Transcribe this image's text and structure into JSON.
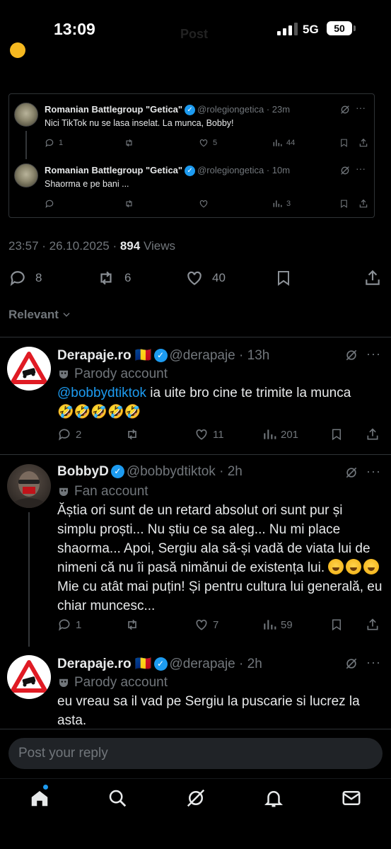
{
  "status_bar": {
    "time": "13:09",
    "network": "5G",
    "battery": "50",
    "behind_title": "Post"
  },
  "quoted_thread": [
    {
      "name": "Romanian Battlegroup \"Getica\"",
      "handle": "@rolegiongetica",
      "time": "23m",
      "text": "Nici TikTok nu se lasa inselat. La munca, Bobby!",
      "replies": "1",
      "retweets": "",
      "likes": "5",
      "views": "44"
    },
    {
      "name": "Romanian Battlegroup \"Getica\"",
      "handle": "@rolegiongetica",
      "time": "10m",
      "text": "Shaorma e pe bani ...",
      "replies": "",
      "retweets": "",
      "likes": "",
      "views": "3"
    }
  ],
  "post_meta": {
    "datetime": "23:57 · 26.10.2025 · ",
    "views_count": "894",
    "views_label": "Views"
  },
  "post_actions": {
    "replies": "8",
    "retweets": "6",
    "likes": "40"
  },
  "sort_label": "Relevant",
  "replies": [
    {
      "name": "Derapaje.ro",
      "flag": "🇷🇴",
      "handle": "@derapaje",
      "time": "13h",
      "tag": "Parody account",
      "mention": "@bobbydtiktok",
      "text": " ia uite bro cine te trimite la munca",
      "emojis": "🤣🤣🤣🤣🤣",
      "replies": "2",
      "retweets": "",
      "likes": "11",
      "views": "201"
    },
    {
      "name": "BobbyD",
      "handle": "@bobbydtiktok",
      "time": "2h",
      "tag": "Fan account",
      "text": "Ăștia ori sunt de un retard absolut ori sunt pur și simplu proști... Nu știu ce sa aleg... Nu mi place shaorma... Apoi, Sergiu ala să-și vadă de viata lui de nimeni că nu îi pasă nimănui de existența lui.",
      "text_end": "Mie cu atât mai puțin! Și pentru cultura lui generală, eu chiar muncesc...",
      "replies": "1",
      "retweets": "",
      "likes": "7",
      "views": "59"
    },
    {
      "name": "Derapaje.ro",
      "flag": "🇷🇴",
      "handle": "@derapaje",
      "time": "2h",
      "tag": "Parody account",
      "text": "eu vreau sa il vad pe Sergiu la puscarie si lucrez la asta."
    }
  ],
  "reply_box": {
    "placeholder": "Post your reply"
  },
  "nav": [
    "home-icon",
    "search-icon",
    "grok-icon",
    "notifications-icon",
    "messages-icon"
  ],
  "colors": {
    "accent": "#1d9bf0",
    "background": "#000000",
    "muted": "#71767b",
    "border": "#2f3336"
  }
}
